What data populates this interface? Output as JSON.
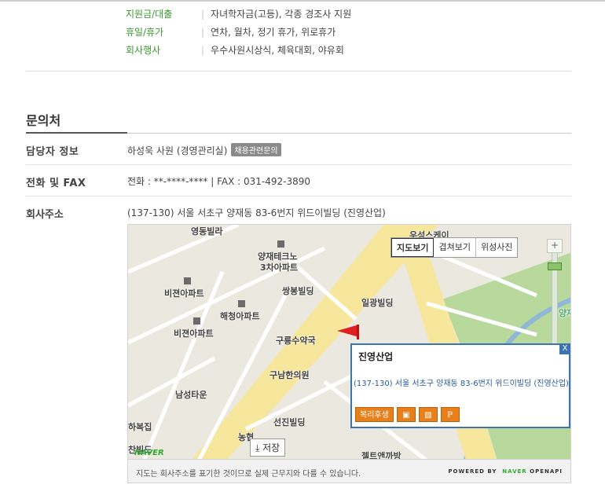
{
  "welfare": [
    {
      "key": "지원금/대출",
      "value": "자녀학자금(고등), 각종 경조사 지원"
    },
    {
      "key": "휴일/휴가",
      "value": "연차, 월차, 정기 휴가, 위로휴가"
    },
    {
      "key": "회사행사",
      "value": "우수사원시상식, 체육대회, 야유회"
    }
  ],
  "contact": {
    "title": "문의처",
    "manager_label": "담당자 정보",
    "manager_value": "하성욱 사원 (경영관리실)",
    "manager_chip": "채용관련문의",
    "phone_label": "전화 및 FAX",
    "phone_value": "전화 : **-****-**** | FAX : 031-492-3890",
    "address_label": "회사주소",
    "address_value": "(137-130) 서울 서초구 양재동 83-6번지 위드이빌딩 (진영산업)"
  },
  "map": {
    "tabs": [
      "지도보기",
      "겹쳐보기",
      "위성사진"
    ],
    "active_tab": "지도보기",
    "zoom_in": "+",
    "zoom_out": "−",
    "labels": [
      "영동빌라",
      "양재테크노",
      "3차아파트",
      "쌍봉빌딩",
      "비젼아파트",
      "해청아파트",
      "비젼아파트",
      "일광빌딩",
      "구룡수약국",
      "구남한의원",
      "남성타운",
      "선진빌딩",
      "농협",
      "하복집",
      "찬빌드",
      "젤트앤까방",
      "우성스케이",
      "양재"
    ],
    "popup": {
      "title": "진영산업",
      "address": "(137-130) 서울 서초구 양재동 83-6번지 위드이빌딩 (진영산업)",
      "close": "X",
      "welfare_button": "복리후생"
    },
    "save_button": "저장",
    "logo": "NAVER",
    "footer_note": "지도는 회사주소를 표기한 것이므로 실제 근무지와 다를 수 있습니다.",
    "credit_powered": "POWERED BY",
    "credit_naver": "NAVER",
    "credit_api": "OPENAPI"
  }
}
